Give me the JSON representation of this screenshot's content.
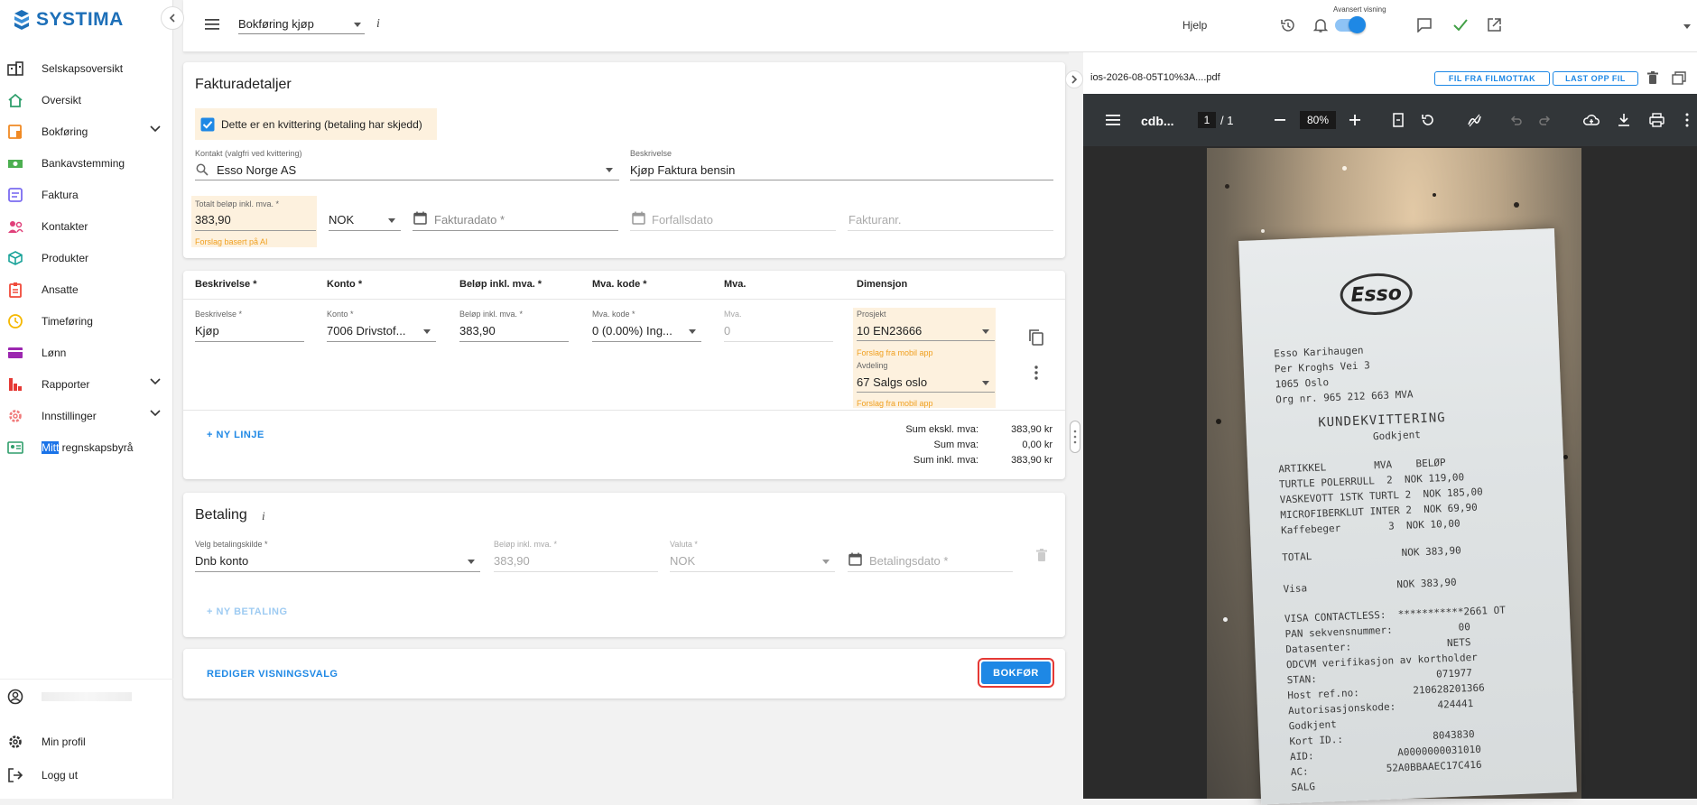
{
  "sidebar": {
    "logo": "SYSTIMA",
    "items": [
      {
        "label": "Selskapsoversikt",
        "icon": "building-icon",
        "color": "#333333"
      },
      {
        "label": "Oversikt",
        "icon": "home-icon",
        "color": "#2e9e6b"
      },
      {
        "label": "Bokføring",
        "icon": "bookkeeping-icon",
        "color": "#f08a24"
      },
      {
        "label": "Bankavstemming",
        "icon": "bank-icon",
        "color": "#4caf50"
      },
      {
        "label": "Faktura",
        "icon": "invoice-icon",
        "color": "#7b6cf0"
      },
      {
        "label": "Kontakter",
        "icon": "contacts-icon",
        "color": "#e0407a"
      },
      {
        "label": "Produkter",
        "icon": "box-icon",
        "color": "#1aa39a"
      },
      {
        "label": "Ansatte",
        "icon": "badge-icon",
        "color": "#f04a3a"
      },
      {
        "label": "Timeføring",
        "icon": "clock-icon",
        "color": "#f5b800"
      },
      {
        "label": "Lønn",
        "icon": "card-icon",
        "color": "#9c27b0"
      },
      {
        "label": "Rapporter",
        "icon": "reports-icon",
        "color": "#e53935"
      },
      {
        "label": "Innstillinger",
        "icon": "gear-icon",
        "color": "#f07a7a"
      },
      {
        "label_highlight": "Mitt",
        "label_rest": " regnskapsbyrå",
        "icon": "id-card-icon",
        "color": "#2e9e6b"
      }
    ],
    "bottom": {
      "profile": "Min profil",
      "logout": "Logg ut"
    }
  },
  "header": {
    "page_select": "Bokføring kjøp",
    "info": "i",
    "help": "Hjelp",
    "advanced_label": "Avansert visning",
    "advanced_on": true
  },
  "invoice": {
    "title": "Fakturadetaljer",
    "receipt_checkbox": "Dette er en kvittering (betaling har skjedd)",
    "contact_label": "Kontakt (valgfri ved kvittering)",
    "contact_value": "Esso Norge AS",
    "description_label": "Beskrivelse",
    "description_value": "Kjøp Faktura bensin",
    "total_label": "Totalt beløp inkl. mva. *",
    "total_value": "383,90",
    "ai_hint": "Forslag basert på AI",
    "currency": "NOK",
    "invoice_date_ph": "Fakturadato *",
    "due_date_ph": "Forfallsdato",
    "invoice_no_ph": "Fakturanr."
  },
  "lines": {
    "headers": [
      "Beskrivelse *",
      "Konto *",
      "Beløp inkl. mva. *",
      "Mva. kode *",
      "Mva.",
      "Dimensjon"
    ],
    "row": {
      "desc_label": "Beskrivelse *",
      "desc": "Kjøp",
      "konto_label": "Konto *",
      "konto": "7006 Drivstof...",
      "amount_label": "Beløp inkl. mva. *",
      "amount": "383,90",
      "vat_code_label": "Mva. kode *",
      "vat_code": "0 (0.00%) Ing...",
      "vat_label": "Mva.",
      "vat": "0",
      "project_label": "Prosjekt",
      "project": "10 EN23666",
      "project_hint": "Forslag fra mobil app",
      "dept_label": "Avdeling",
      "dept": "67 Salgs oslo",
      "dept_hint": "Forslag fra mobil app"
    },
    "new_line": "+ NY LINJE",
    "sums": [
      {
        "label": "Sum ekskl. mva:",
        "value": "383,90 kr"
      },
      {
        "label": "Sum mva:",
        "value": "0,00 kr"
      },
      {
        "label": "Sum inkl. mva:",
        "value": "383,90 kr"
      }
    ]
  },
  "payment": {
    "title": "Betaling",
    "info": "i",
    "source_label": "Velg betalingskilde *",
    "source": "Dnb konto",
    "amount_label": "Beløp inkl. mva. *",
    "amount": "383,90",
    "currency_label": "Valuta *",
    "currency": "NOK",
    "date_ph": "Betalingsdato *",
    "new_payment": "+ NY BETALING"
  },
  "footer": {
    "edit_view": "REDIGER VISNINGSVALG",
    "book": "BOKFØR"
  },
  "pdf": {
    "filename": "ios-2026-08-05T10%3A....pdf",
    "from_inbox": "FIL FRA FILMOTTAK",
    "upload": "LAST OPP FIL",
    "viewer_title": "cdb...",
    "page": "1",
    "page_of": "/  1",
    "zoom": "80%"
  },
  "receipt": {
    "logo": "Esso",
    "lines": [
      "Esso Karihaugen",
      "Per Kroghs Vei 3",
      "1065 Oslo",
      "Org nr. 965 212 663 MVA",
      "KUNDEKVITTERING",
      "Godkjent",
      "ARTIKKEL        MVA    BELØP",
      "TURTLE POLERRULL  2  NOK 119,00",
      "VASKEVOTT 1STK TURTL 2  NOK 185,00",
      "MICROFIBERKLUT INTER 2  NOK 69,90",
      "Kaffebeger        3  NOK 10,00",
      "TOTAL               NOK 383,90",
      "Visa               NOK 383,90",
      "VISA CONTACTLESS:  ***********2661 OT",
      "PAN sekvensnummer:           00",
      "Datasenter:                NETS",
      "ODCVM verifikasjon av kortholder",
      "STAN:                    071977",
      "Host ref.no:         210628201366",
      "Autorisasjonskode:       424441",
      "Godkjent",
      "Kort ID.:               8043830",
      "AID:              A0000000031010",
      "AC:             52A0BBAAEC17C416",
      "SALG"
    ]
  }
}
